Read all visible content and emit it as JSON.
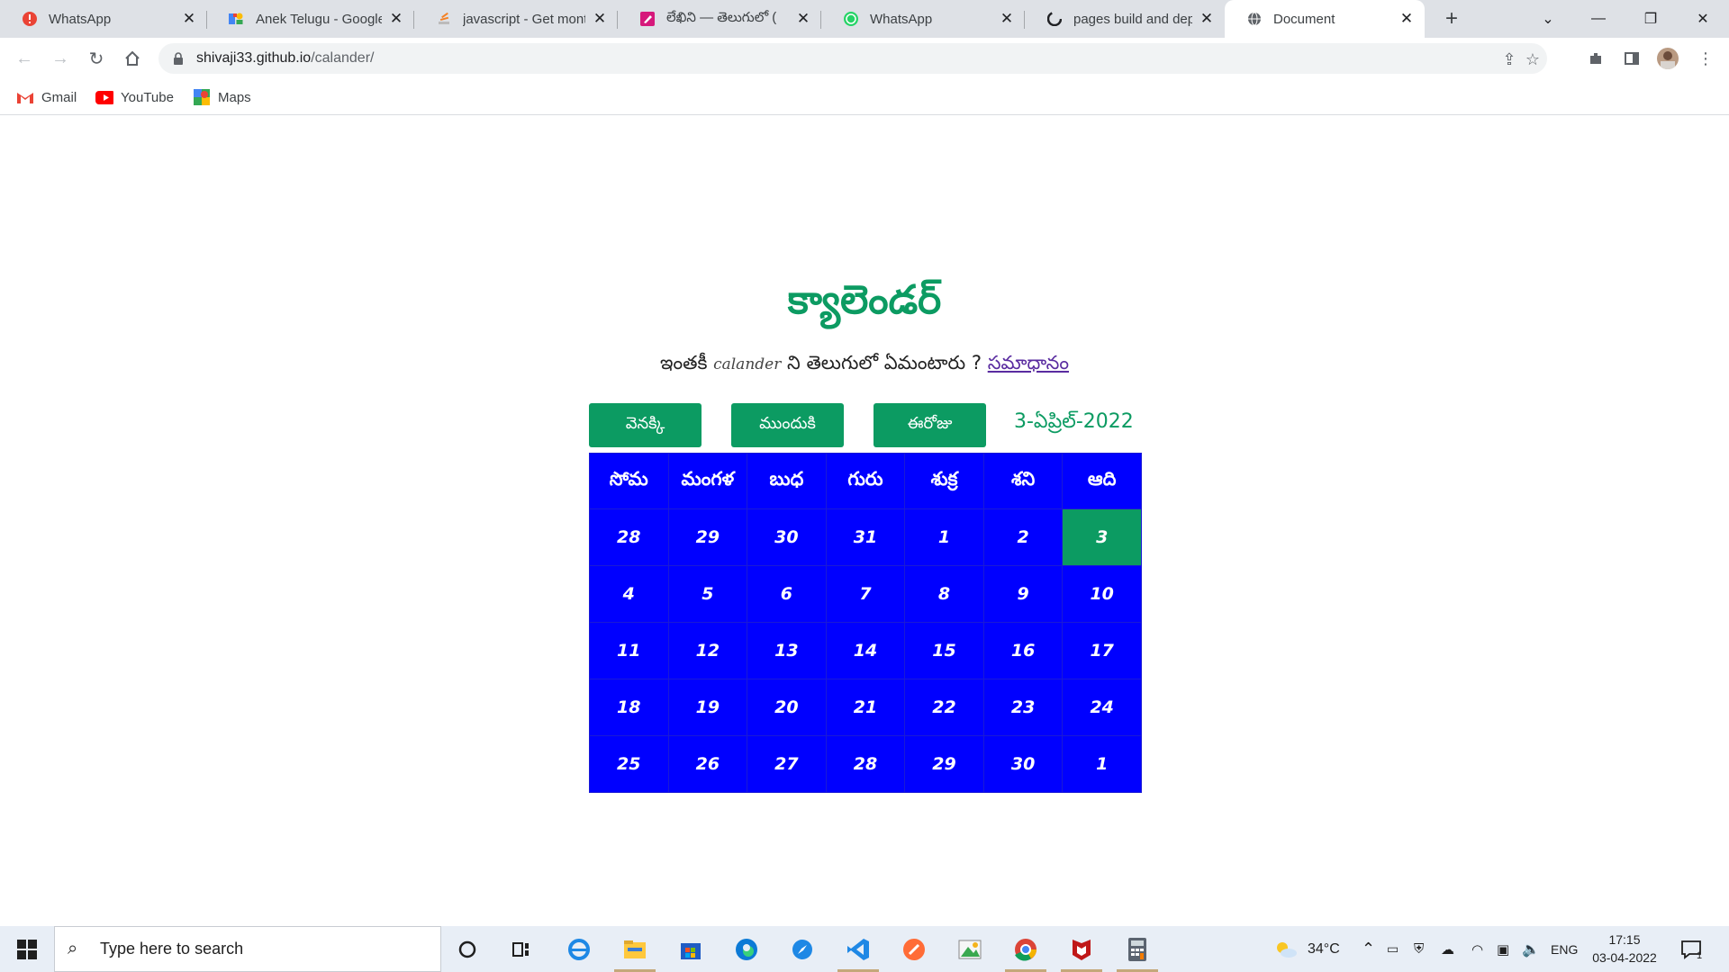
{
  "browser": {
    "tabs": [
      {
        "title": "WhatsApp",
        "icon": "whatsapp-alert-icon"
      },
      {
        "title": "Anek Telugu - Google",
        "icon": "google-fonts-icon"
      },
      {
        "title": "javascript - Get month",
        "icon": "stackoverflow-icon"
      },
      {
        "title": "లేఖిని — తెలుగులో (",
        "icon": "lekhini-icon"
      },
      {
        "title": "WhatsApp",
        "icon": "whatsapp-icon"
      },
      {
        "title": "pages build and deplo",
        "icon": "github-icon"
      },
      {
        "title": "Document",
        "icon": "globe-icon",
        "active": true
      }
    ],
    "url_host": "shivaji33.github.io",
    "url_path": "/calander/",
    "bookmarks": [
      {
        "label": "Gmail",
        "icon": "gmail-icon"
      },
      {
        "label": "YouTube",
        "icon": "youtube-icon"
      },
      {
        "label": "Maps",
        "icon": "maps-icon"
      }
    ]
  },
  "page": {
    "title": "క్యాలెండర్",
    "subtitle_pre": "ఇంతకీ",
    "subtitle_en": "calander",
    "subtitle_post": "ని తెలుగులో ఏమంటారు ?",
    "answer_link": "సమాధానం",
    "buttons": {
      "prev": "వెనక్కి",
      "next": "ముందుకి",
      "today": "ఈరోజు"
    },
    "current_date": "3-ఏప్రిల్-2022",
    "weekdays": [
      "సోమ",
      "మంగళ",
      "బుధ",
      "గురు",
      "శుక్ర",
      "శని",
      "ఆది"
    ],
    "weeks": [
      [
        "28",
        "29",
        "30",
        "31",
        "1",
        "2",
        "3"
      ],
      [
        "4",
        "5",
        "6",
        "7",
        "8",
        "9",
        "10"
      ],
      [
        "11",
        "12",
        "13",
        "14",
        "15",
        "16",
        "17"
      ],
      [
        "18",
        "19",
        "20",
        "21",
        "22",
        "23",
        "24"
      ],
      [
        "25",
        "26",
        "27",
        "28",
        "29",
        "30",
        "1"
      ]
    ],
    "today_cell": {
      "week": 0,
      "day": 6
    },
    "colors": {
      "green": "#0c9b62",
      "calendar_bg": "#0000ff"
    }
  },
  "taskbar": {
    "search_placeholder": "Type here to search",
    "weather": "34°C",
    "language": "ENG",
    "time": "17:15",
    "date": "03-04-2022",
    "notifications": "1"
  }
}
